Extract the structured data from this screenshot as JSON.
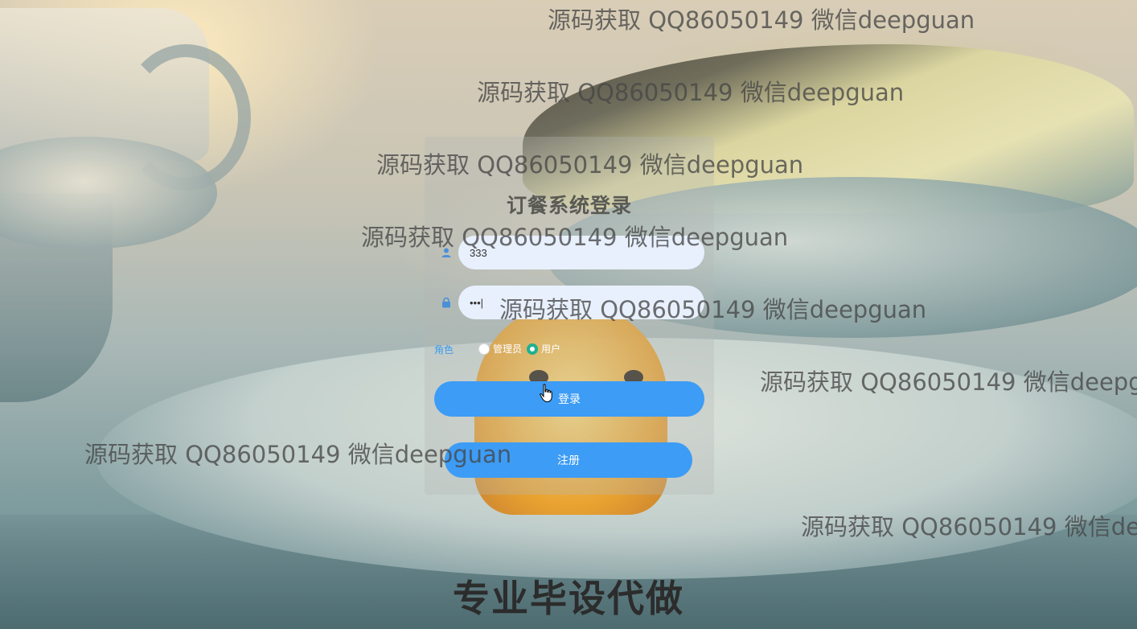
{
  "login": {
    "title": "订餐系统登录",
    "username_value": "333",
    "password_value": "•••|",
    "role_label": "角色",
    "role_options": [
      "管理员",
      "用户"
    ],
    "selected_role": "用户",
    "login_button": "登录",
    "register_button": "注册"
  },
  "watermarks": [
    "源码获取 QQ86050149 微信deepguan",
    "源码获取 QQ86050149 微信deepguan",
    "源码获取 QQ86050149 微信deepguan",
    "源码获取 QQ86050149 微信deepguan",
    "源码获取 QQ86050149 微信deepguan",
    "源码获取 QQ86050149 微信deepg",
    "源码获取 QQ86050149 微信deepguan",
    "源码获取 QQ86050149 微信de"
  ],
  "caption": "专业毕设代做",
  "icons": {
    "username": "user-icon",
    "password": "lock-icon",
    "cursor": "hand-pointer-icon"
  },
  "colors": {
    "accent": "#3d9cf5",
    "input_bg": "#e8f0fe",
    "radio_checked": "#20b090"
  }
}
